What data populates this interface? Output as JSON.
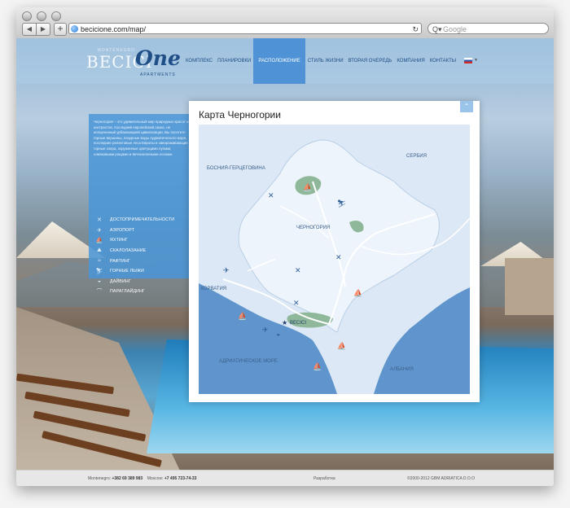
{
  "browser": {
    "url": "becicione.com/map/",
    "search_placeholder": "Google",
    "back_icon": "◀",
    "forward_icon": "▶",
    "add_icon": "+",
    "reload_icon": "↻",
    "search_icon": "Q▾"
  },
  "logo": {
    "top": "MONTENEGRO",
    "main": "BECICI",
    "one": "One",
    "sub": "APARTMENTS"
  },
  "nav": {
    "items": [
      "КОМПЛЕКС",
      "ПЛАНИРОВКИ",
      "РАСПОЛОЖЕНИЕ",
      "СТИЛЬ ЖИЗНИ",
      "ВТОРАЯ ОЧЕРЕДЬ",
      "КОМПАНИЯ",
      "КОНТАКТЫ"
    ],
    "active_index": 2
  },
  "sidebar": {
    "intro": "Черногория – это удивительный мир природных красот и контрастов, последний европейский оазис, не испорченный урбанизацией цивилизации. Вы посетите горные вершины, лазурные воды Адриатического моря, последние реликтовые леса Европы и завораживающие горные озера, окруженные цветущими лугами, оливковыми рощами и вечнозелеными лесами.",
    "legend": [
      {
        "icon": "✕",
        "label": "ДОСТОПРИМЕЧАТЕЛЬНОСТИ"
      },
      {
        "icon": "✈",
        "label": "АЭРОПОРТ"
      },
      {
        "icon": "⛵",
        "label": "ЯХТИНГ"
      },
      {
        "icon": "⛰",
        "label": "СКАЛОЛАЗАНИЕ"
      },
      {
        "icon": "≈",
        "label": "РАФТИНГ"
      },
      {
        "icon": "⛷",
        "label": "ГОРНЫЕ ЛЫЖИ"
      },
      {
        "icon": "◒",
        "label": "ДАЙВИНГ"
      },
      {
        "icon": "⌒",
        "label": "ПАРАГЛАЙДИНГ"
      }
    ]
  },
  "map": {
    "title": "Карта Черногории",
    "up_icon": "⌃",
    "labels": {
      "serbia": "СЕРБИЯ",
      "bosnia": "БОСНИЯ-ГЕРЦЕГОВИНА",
      "montenegro": "ЧЕРНОГОРИЯ",
      "croatia": "ХОРВАТИЯ",
      "adriatic": "АДРИАТИЧЕСКОЕ МОРЕ",
      "albania": "АЛБАНИЯ",
      "marker": "BECICI"
    },
    "colors": {
      "sea": "#5f95cc",
      "land": "#dce8f5",
      "montenegro": "#eef4fb",
      "park": "#8fb89a",
      "road": "#ffffff",
      "icon": "#2f5f99"
    }
  },
  "footer": {
    "phone_label_1": "Montenegro:",
    "phone_1": "+382 69 389 983",
    "phone_label_2": "Moscow:",
    "phone_2": "+7 495 723-74-33",
    "dev": "Разработка",
    "copyright": "©2000-2012 GBM ADRIATICA D.O.O"
  }
}
